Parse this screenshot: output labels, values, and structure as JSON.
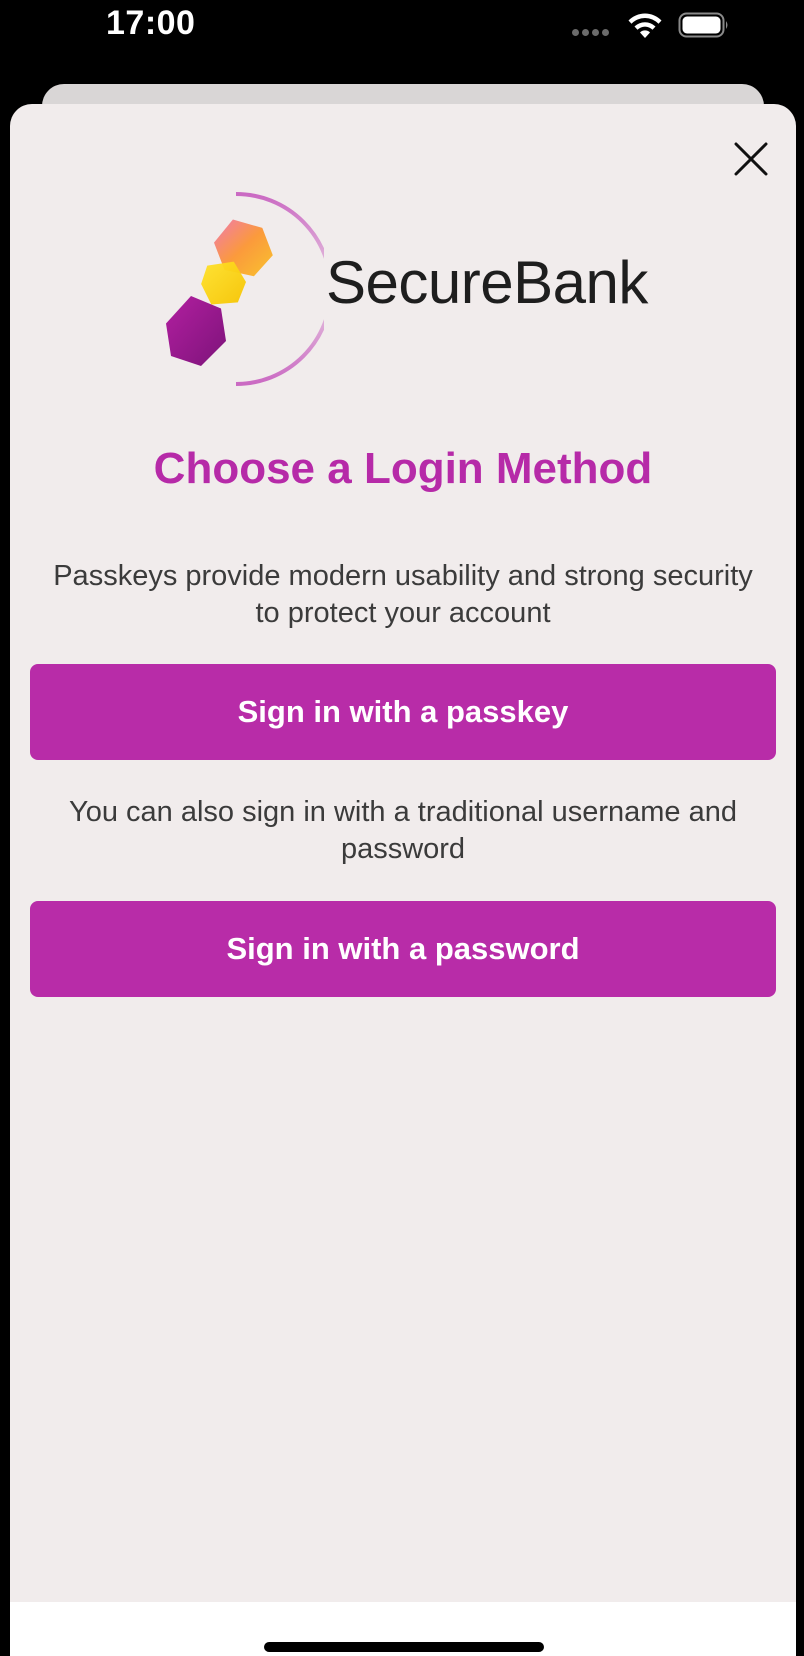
{
  "status_bar": {
    "time": "17:00",
    "icons": [
      "signal-dots-icon",
      "wifi-icon",
      "battery-icon"
    ]
  },
  "brand": {
    "name": "SecureBank",
    "logo_icon": "hexagon-logo-icon"
  },
  "dialog": {
    "close_icon": "close-icon",
    "title": "Choose a Login Method",
    "passkey_description": "Passkeys provide modern usability and strong security to protect your account",
    "passkey_button_label": "Sign in with a passkey",
    "password_description": "You can also sign in with a traditional username and password",
    "password_button_label": "Sign in with a password"
  },
  "colors": {
    "accent": "#b82ca8",
    "title": "#b62aa8",
    "sheet_background": "#f1ecec",
    "text": "#3b3b3b"
  }
}
